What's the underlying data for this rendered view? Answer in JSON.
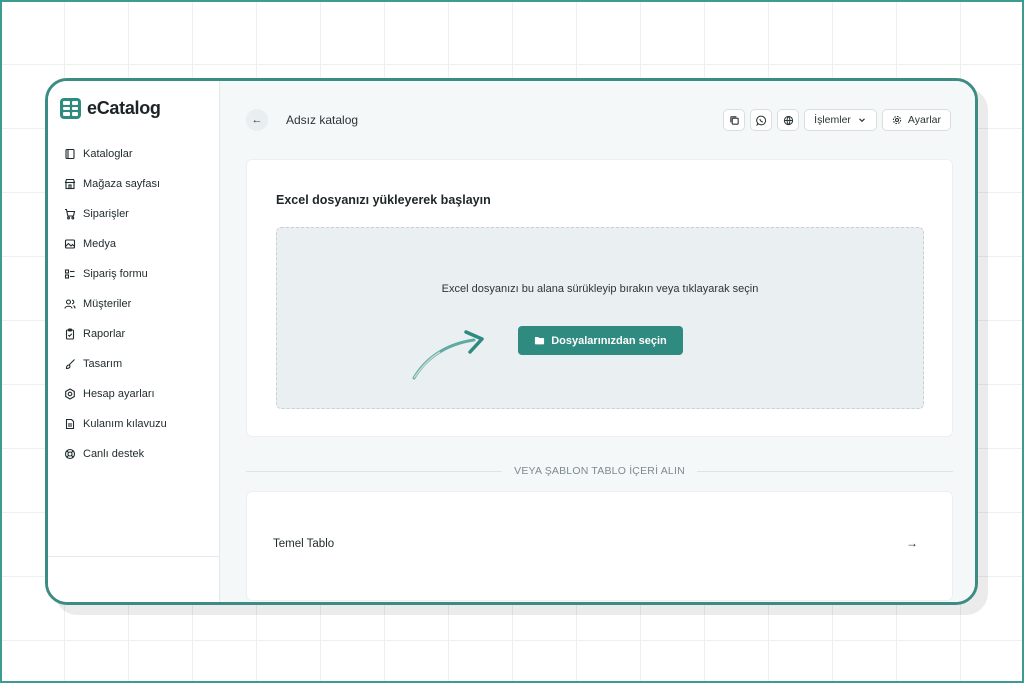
{
  "app": {
    "name": "eCatalog"
  },
  "sidebar": {
    "items": [
      {
        "label": "Kataloglar",
        "icon": "book-icon"
      },
      {
        "label": "Mağaza sayfası",
        "icon": "store-icon"
      },
      {
        "label": "Siparişler",
        "icon": "cart-icon"
      },
      {
        "label": "Medya",
        "icon": "image-icon"
      },
      {
        "label": "Sipariş formu",
        "icon": "form-icon"
      },
      {
        "label": "Müşteriler",
        "icon": "users-icon"
      },
      {
        "label": "Raporlar",
        "icon": "clipboard-icon"
      },
      {
        "label": "Tasarım",
        "icon": "brush-icon"
      },
      {
        "label": "Hesap ayarları",
        "icon": "settings-icon"
      },
      {
        "label": "Kulanım kılavuzu",
        "icon": "document-icon"
      },
      {
        "label": "Canlı destek",
        "icon": "lifebuoy-icon"
      }
    ]
  },
  "header": {
    "back_icon": "←",
    "title": "Adsız katalog",
    "actions_label": "İşlemler",
    "settings_label": "Ayarlar"
  },
  "upload": {
    "title": "Excel dosyanızı yükleyerek başlayın",
    "dropzone_text": "Excel dosyanızı bu alana sürükleyip bırakın veya tıklayarak seçin",
    "button_label": "Dosyalarınızdan seçin"
  },
  "divider": {
    "text": "VEYA ŞABLON TABLO İÇERİ ALIN"
  },
  "templates": [
    {
      "name": "Temel Tablo",
      "arrow": "→"
    }
  ],
  "colors": {
    "accent": "#2f8a80",
    "frame": "#3d8c84"
  }
}
